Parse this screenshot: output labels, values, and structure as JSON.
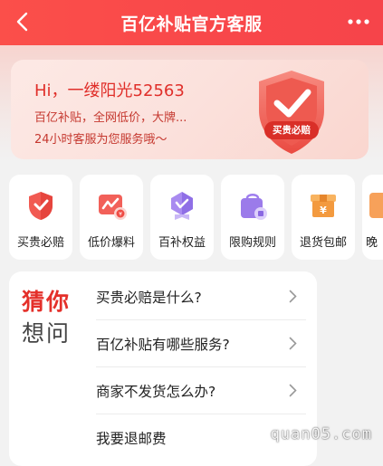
{
  "header": {
    "title": "百亿补贴官方客服"
  },
  "banner": {
    "greeting": "Hi，一缕阳光52563",
    "line1": "百亿补贴，全网低价，大牌...",
    "line2": "24小时客服为您服务哦～",
    "badge_text": "买贵必赔"
  },
  "features": [
    {
      "label": "买贵必赔",
      "icon": "shield-check-icon"
    },
    {
      "label": "低价爆料",
      "icon": "price-chart-icon"
    },
    {
      "label": "百补权益",
      "icon": "medal-icon"
    },
    {
      "label": "限购规则",
      "icon": "shopping-bag-icon"
    },
    {
      "label": "退货包邮",
      "icon": "yuan-box-icon"
    },
    {
      "label": "晚"
    }
  ],
  "guess": {
    "title1": "猜你",
    "title2": "想问",
    "questions": [
      "买贵必赔是什么?",
      "百亿补贴有哪些服务?",
      "商家不发货怎么办?",
      "我要退邮费"
    ]
  },
  "watermark": "quan05.com",
  "colors": {
    "header": "#f8474a",
    "accent": "#e4302a",
    "shield": "#f15a52",
    "purple": "#9b7bea",
    "orange": "#f6a04a"
  }
}
